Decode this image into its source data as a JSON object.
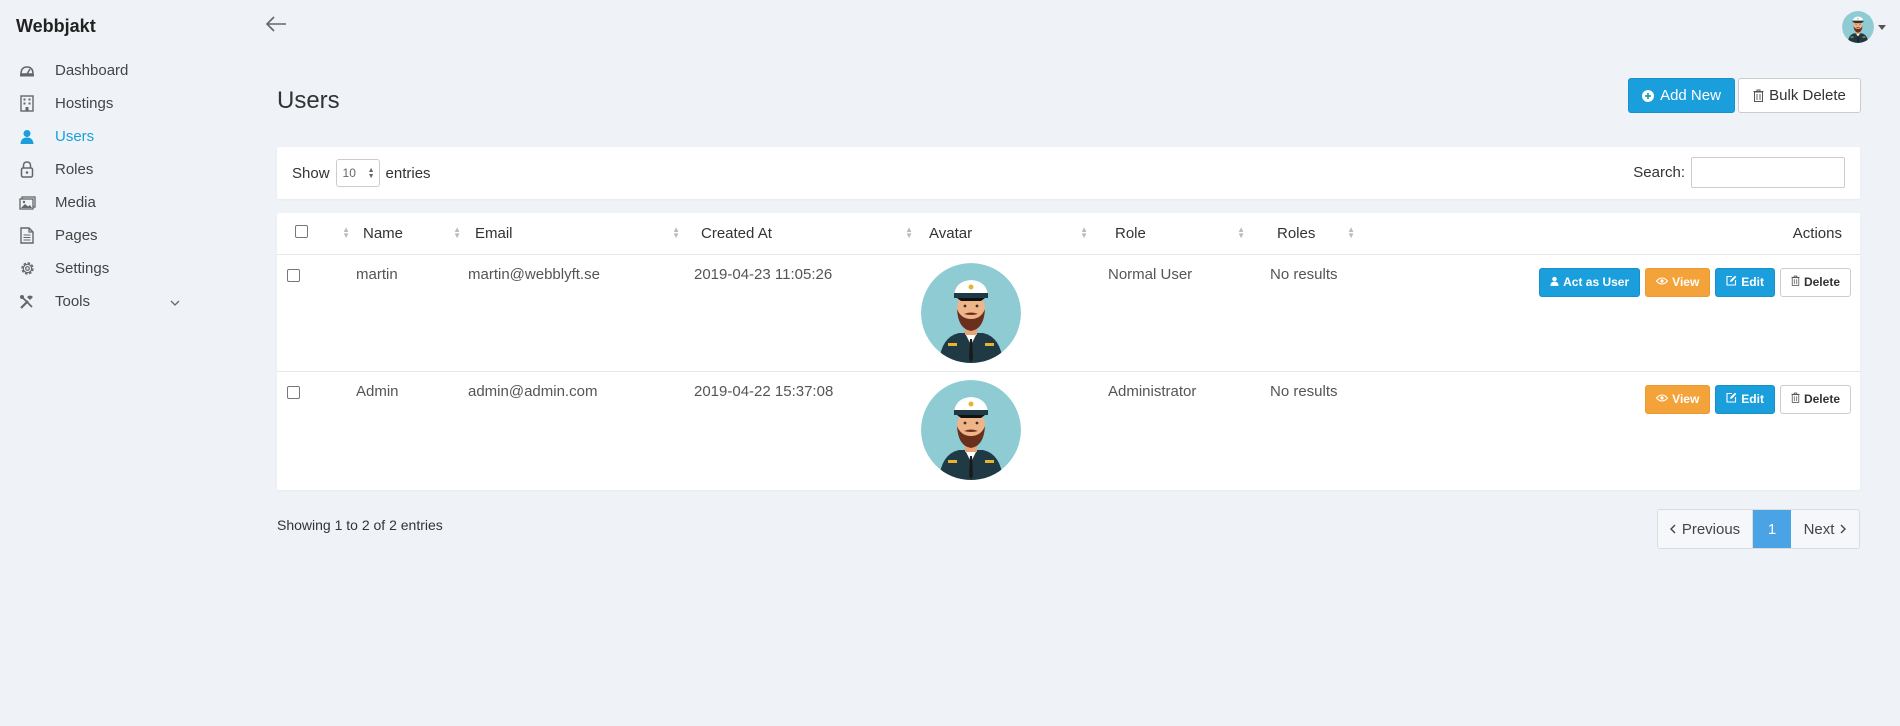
{
  "app": {
    "brand": "Webbjakt"
  },
  "sidebar": {
    "items": [
      {
        "label": "Dashboard",
        "icon": "dashboard-icon"
      },
      {
        "label": "Hostings",
        "icon": "building-icon"
      },
      {
        "label": "Users",
        "icon": "user-icon",
        "active": true
      },
      {
        "label": "Roles",
        "icon": "lock-icon"
      },
      {
        "label": "Media",
        "icon": "image-icon"
      },
      {
        "label": "Pages",
        "icon": "file-icon"
      },
      {
        "label": "Settings",
        "icon": "gear-icon"
      },
      {
        "label": "Tools",
        "icon": "tools-icon"
      }
    ]
  },
  "page": {
    "title": "Users",
    "add_new_label": "Add New",
    "bulk_delete_label": "Bulk Delete"
  },
  "filter": {
    "show_label": "Show",
    "length_value": "10",
    "entries_label": "entries",
    "search_label": "Search:",
    "search_value": ""
  },
  "table": {
    "headers": [
      "",
      "Name",
      "Email",
      "Created At",
      "Avatar",
      "Role",
      "Roles",
      "Actions"
    ],
    "rows": [
      {
        "name": "martin",
        "email": "martin@webblyft.se",
        "created_at": "2019-04-23 11:05:26",
        "role": "Normal User",
        "roles": "No results",
        "actions": [
          "Act as User",
          "View",
          "Edit",
          "Delete"
        ]
      },
      {
        "name": "Admin",
        "email": "admin@admin.com",
        "created_at": "2019-04-22 15:37:08",
        "role": "Administrator",
        "roles": "No results",
        "actions": [
          "View",
          "Edit",
          "Delete"
        ]
      }
    ]
  },
  "footer": {
    "info": "Showing 1 to 2 of 2 entries",
    "previous": "Previous",
    "current_page": "1",
    "next": "Next"
  },
  "colors": {
    "accent": "#1a9fdc",
    "warning": "#f4a33a",
    "background": "#eff3f8",
    "pagination_active": "#4aa3e5"
  }
}
